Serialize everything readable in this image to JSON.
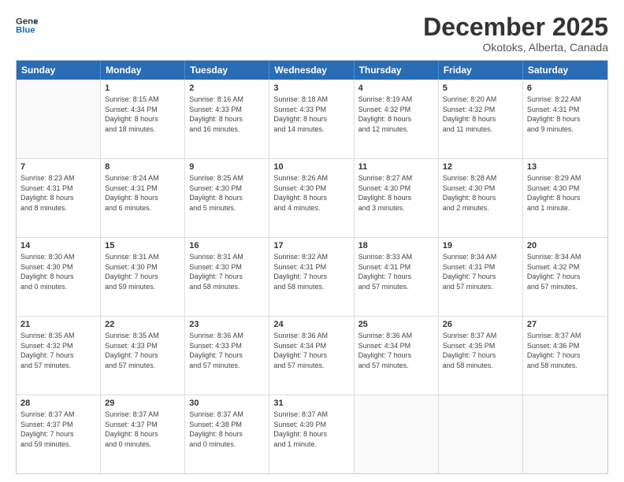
{
  "logo": {
    "line1": "General",
    "line2": "Blue"
  },
  "title": "December 2025",
  "subtitle": "Okotoks, Alberta, Canada",
  "headers": [
    "Sunday",
    "Monday",
    "Tuesday",
    "Wednesday",
    "Thursday",
    "Friday",
    "Saturday"
  ],
  "rows": [
    [
      {
        "day": "",
        "info": ""
      },
      {
        "day": "1",
        "info": "Sunrise: 8:15 AM\nSunset: 4:34 PM\nDaylight: 8 hours\nand 18 minutes."
      },
      {
        "day": "2",
        "info": "Sunrise: 8:16 AM\nSunset: 4:33 PM\nDaylight: 8 hours\nand 16 minutes."
      },
      {
        "day": "3",
        "info": "Sunrise: 8:18 AM\nSunset: 4:33 PM\nDaylight: 8 hours\nand 14 minutes."
      },
      {
        "day": "4",
        "info": "Sunrise: 8:19 AM\nSunset: 4:32 PM\nDaylight: 8 hours\nand 12 minutes."
      },
      {
        "day": "5",
        "info": "Sunrise: 8:20 AM\nSunset: 4:32 PM\nDaylight: 8 hours\nand 11 minutes."
      },
      {
        "day": "6",
        "info": "Sunrise: 8:22 AM\nSunset: 4:31 PM\nDaylight: 8 hours\nand 9 minutes."
      }
    ],
    [
      {
        "day": "7",
        "info": "Sunrise: 8:23 AM\nSunset: 4:31 PM\nDaylight: 8 hours\nand 8 minutes."
      },
      {
        "day": "8",
        "info": "Sunrise: 8:24 AM\nSunset: 4:31 PM\nDaylight: 8 hours\nand 6 minutes."
      },
      {
        "day": "9",
        "info": "Sunrise: 8:25 AM\nSunset: 4:30 PM\nDaylight: 8 hours\nand 5 minutes."
      },
      {
        "day": "10",
        "info": "Sunrise: 8:26 AM\nSunset: 4:30 PM\nDaylight: 8 hours\nand 4 minutes."
      },
      {
        "day": "11",
        "info": "Sunrise: 8:27 AM\nSunset: 4:30 PM\nDaylight: 8 hours\nand 3 minutes."
      },
      {
        "day": "12",
        "info": "Sunrise: 8:28 AM\nSunset: 4:30 PM\nDaylight: 8 hours\nand 2 minutes."
      },
      {
        "day": "13",
        "info": "Sunrise: 8:29 AM\nSunset: 4:30 PM\nDaylight: 8 hours\nand 1 minute."
      }
    ],
    [
      {
        "day": "14",
        "info": "Sunrise: 8:30 AM\nSunset: 4:30 PM\nDaylight: 8 hours\nand 0 minutes."
      },
      {
        "day": "15",
        "info": "Sunrise: 8:31 AM\nSunset: 4:30 PM\nDaylight: 7 hours\nand 59 minutes."
      },
      {
        "day": "16",
        "info": "Sunrise: 8:31 AM\nSunset: 4:30 PM\nDaylight: 7 hours\nand 58 minutes."
      },
      {
        "day": "17",
        "info": "Sunrise: 8:32 AM\nSunset: 4:31 PM\nDaylight: 7 hours\nand 58 minutes."
      },
      {
        "day": "18",
        "info": "Sunrise: 8:33 AM\nSunset: 4:31 PM\nDaylight: 7 hours\nand 57 minutes."
      },
      {
        "day": "19",
        "info": "Sunrise: 8:34 AM\nSunset: 4:31 PM\nDaylight: 7 hours\nand 57 minutes."
      },
      {
        "day": "20",
        "info": "Sunrise: 8:34 AM\nSunset: 4:32 PM\nDaylight: 7 hours\nand 57 minutes."
      }
    ],
    [
      {
        "day": "21",
        "info": "Sunrise: 8:35 AM\nSunset: 4:32 PM\nDaylight: 7 hours\nand 57 minutes."
      },
      {
        "day": "22",
        "info": "Sunrise: 8:35 AM\nSunset: 4:33 PM\nDaylight: 7 hours\nand 57 minutes."
      },
      {
        "day": "23",
        "info": "Sunrise: 8:36 AM\nSunset: 4:33 PM\nDaylight: 7 hours\nand 57 minutes."
      },
      {
        "day": "24",
        "info": "Sunrise: 8:36 AM\nSunset: 4:34 PM\nDaylight: 7 hours\nand 57 minutes."
      },
      {
        "day": "25",
        "info": "Sunrise: 8:36 AM\nSunset: 4:34 PM\nDaylight: 7 hours\nand 57 minutes."
      },
      {
        "day": "26",
        "info": "Sunrise: 8:37 AM\nSunset: 4:35 PM\nDaylight: 7 hours\nand 58 minutes."
      },
      {
        "day": "27",
        "info": "Sunrise: 8:37 AM\nSunset: 4:36 PM\nDaylight: 7 hours\nand 58 minutes."
      }
    ],
    [
      {
        "day": "28",
        "info": "Sunrise: 8:37 AM\nSunset: 4:37 PM\nDaylight: 7 hours\nand 59 minutes."
      },
      {
        "day": "29",
        "info": "Sunrise: 8:37 AM\nSunset: 4:37 PM\nDaylight: 8 hours\nand 0 minutes."
      },
      {
        "day": "30",
        "info": "Sunrise: 8:37 AM\nSunset: 4:38 PM\nDaylight: 8 hours\nand 0 minutes."
      },
      {
        "day": "31",
        "info": "Sunrise: 8:37 AM\nSunset: 4:39 PM\nDaylight: 8 hours\nand 1 minute."
      },
      {
        "day": "",
        "info": ""
      },
      {
        "day": "",
        "info": ""
      },
      {
        "day": "",
        "info": ""
      }
    ]
  ]
}
